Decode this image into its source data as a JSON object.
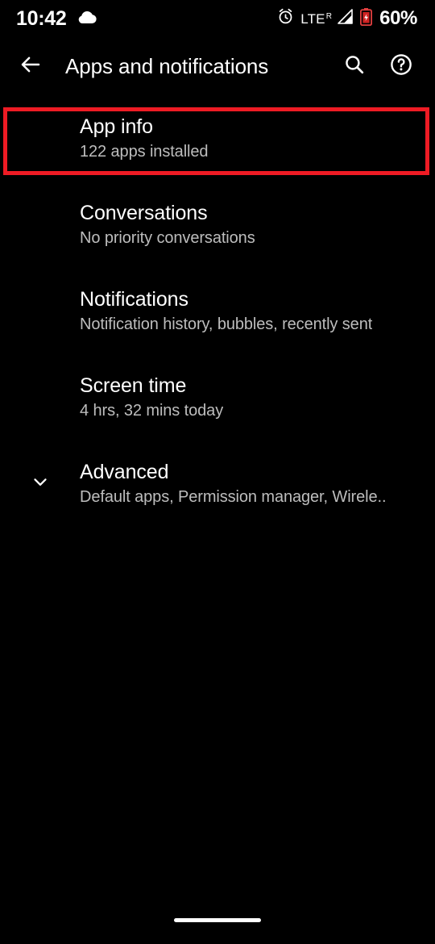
{
  "status_bar": {
    "time": "10:42",
    "weather_icon": "cloud-icon",
    "alarm_icon": "alarm-icon",
    "network_label": "LTE",
    "network_roaming": "R",
    "signal_icon": "signal-bars-icon",
    "battery_icon": "battery-low-icon",
    "battery_percent": "60%",
    "battery_color": "#e03f3f"
  },
  "app_bar": {
    "back_icon": "arrow-back-icon",
    "title": "Apps and notifications",
    "search_icon": "search-icon",
    "help_icon": "help-circle-icon"
  },
  "list": {
    "items": [
      {
        "title": "App info",
        "summary": "122 apps installed",
        "expander": false,
        "highlighted": true
      },
      {
        "title": "Conversations",
        "summary": "No priority conversations",
        "expander": false,
        "highlighted": false
      },
      {
        "title": "Notifications",
        "summary": "Notification history, bubbles, recently sent",
        "expander": false,
        "highlighted": false
      },
      {
        "title": "Screen time",
        "summary": "4 hrs, 32 mins today",
        "expander": false,
        "highlighted": false
      },
      {
        "title": "Advanced",
        "summary": "Default apps, Permission manager, Wirele..",
        "expander": true,
        "expander_icon": "chevron-down-icon",
        "highlighted": false
      }
    ]
  },
  "annotation": {
    "highlight_color": "#ee1b24",
    "target": "App info"
  },
  "nav_bar": {
    "home_indicator": "home-gesture-bar"
  }
}
